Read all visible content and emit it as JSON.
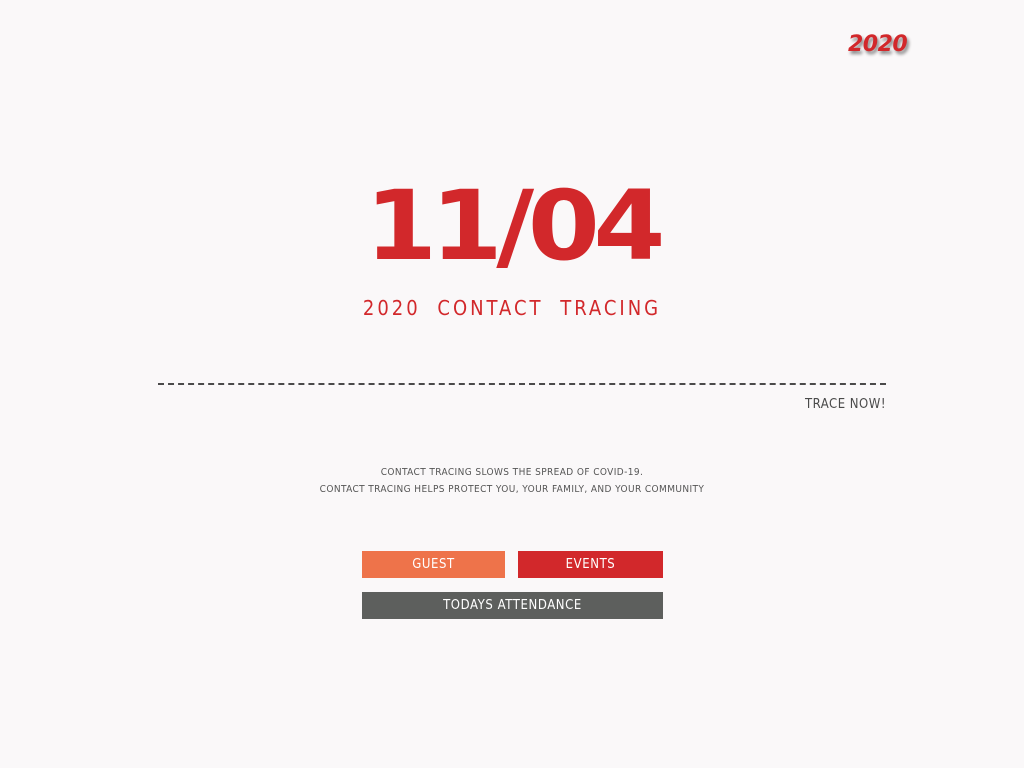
{
  "header": {
    "year_badge": "2020"
  },
  "hero": {
    "date": "11/04",
    "subtitle": "2020  CONTACT TRACING"
  },
  "cta": {
    "trace_link": "TRACE NOW!"
  },
  "info": {
    "line1": "CONTACT TRACING SLOWS THE SPREAD OF COVID-19.",
    "line2": "CONTACT TRACING HELPS PROTECT YOU, YOUR FAMILY, AND YOUR COMMUNITY"
  },
  "buttons": {
    "guest": "GUEST",
    "events": "EVENTS",
    "attendance": "TODAYS ATTENDANCE"
  },
  "colors": {
    "accent_red": "#d2282b",
    "accent_orange": "#ee734a",
    "neutral_gray": "#5d5f5d",
    "background": "#faf8f9"
  }
}
